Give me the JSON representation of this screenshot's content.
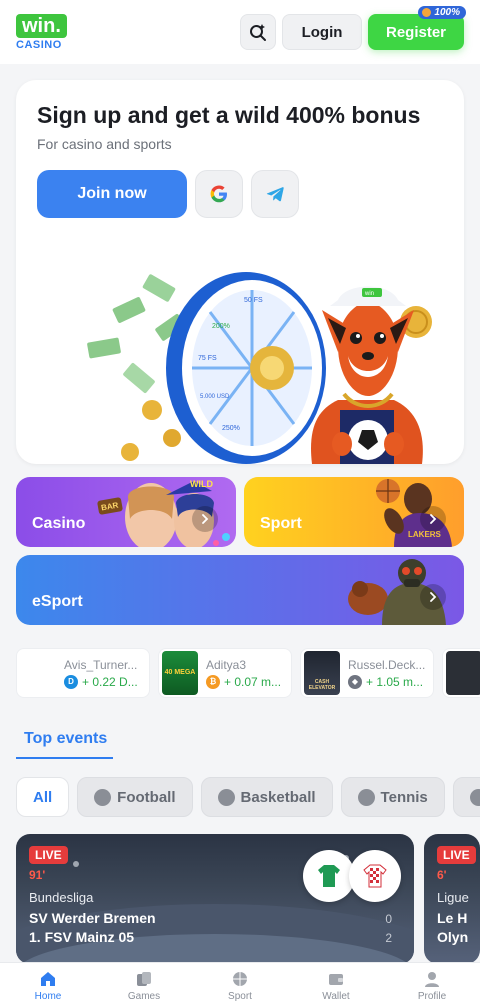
{
  "header": {
    "logo_top": "win.",
    "logo_bottom": "CASINO",
    "login_label": "Login",
    "register_label": "Register",
    "register_badge": "100%"
  },
  "promo": {
    "title": "Sign up and get a wild 400% bonus",
    "subtitle": "For casino and sports",
    "join_label": "Join now",
    "google_icon": "google-icon",
    "telegram_icon": "telegram-icon",
    "wheel_segments": [
      "50 FS",
      "200%",
      "75 FS",
      "5.000 USD",
      "250%"
    ],
    "cap_text": "win"
  },
  "categories": [
    {
      "label": "Casino",
      "badges": [
        "BAR",
        "WILD"
      ]
    },
    {
      "label": "Sport"
    },
    {
      "label": "eSport"
    }
  ],
  "recent_wins": [
    {
      "name": "Avis_Turner...",
      "amount": "+ 0.22 D...",
      "currency_icon": "dash-icon",
      "currency_color": "#1a8de0"
    },
    {
      "name": "Aditya3",
      "amount": "+ 0.07 m...",
      "currency_icon": "bitcoin-icon",
      "currency_color": "#f59a23",
      "thumb_text": "40 MEGA"
    },
    {
      "name": "Russel.Deck...",
      "amount": "+ 1.05 m...",
      "currency_icon": "ethereum-icon",
      "currency_color": "#6f7480",
      "thumb_text": "CASH ELEVATOR"
    }
  ],
  "events": {
    "title": "Top events",
    "filters": [
      {
        "label": "All",
        "active": true
      },
      {
        "label": "Football",
        "icon": "football-icon"
      },
      {
        "label": "Basketball",
        "icon": "basketball-icon"
      },
      {
        "label": "Tennis",
        "icon": "tennis-icon"
      }
    ],
    "matches": [
      {
        "live": "LIVE",
        "minute": "91'",
        "league": "Bundesliga",
        "home": "SV Werder Bremen",
        "away": "1. FSV Mainz 05",
        "home_score": "0",
        "away_score": "2"
      },
      {
        "live": "LIVE",
        "minute": "6'",
        "league": "Ligue",
        "home": "Le H",
        "away": "Olyn"
      }
    ]
  },
  "nav": [
    {
      "label": "Home",
      "icon": "home-icon",
      "active": true
    },
    {
      "label": "Games",
      "icon": "games-icon"
    },
    {
      "label": "Sport",
      "icon": "sport-ball-icon"
    },
    {
      "label": "Wallet",
      "icon": "wallet-icon"
    },
    {
      "label": "Profile",
      "icon": "profile-icon"
    }
  ],
  "colors": {
    "accent": "#2f7df0",
    "register": "#3ed644",
    "live": "#e63c3c",
    "win_amount": "#2aa94a"
  }
}
